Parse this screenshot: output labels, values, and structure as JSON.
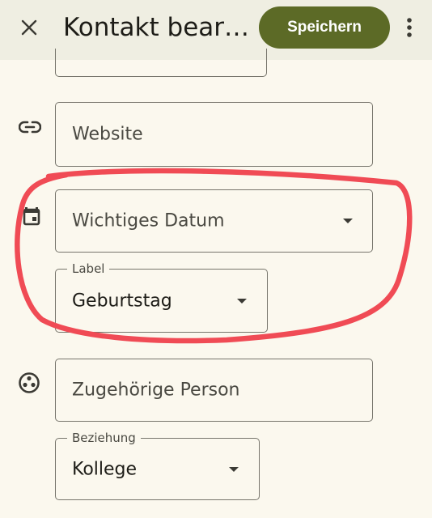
{
  "app_bar": {
    "title": "Kontakt bearb…",
    "save_label": "Speichern",
    "close_icon": "close-icon",
    "more_icon": "more-vert-icon"
  },
  "form": {
    "website": {
      "placeholder": "Website",
      "icon": "link-icon"
    },
    "important_date": {
      "placeholder": "Wichtiges Datum",
      "icon": "event-icon"
    },
    "date_label": {
      "label": "Label",
      "value": "Geburtstag"
    },
    "related_person": {
      "placeholder": "Zugehörige Person",
      "icon": "person-circle-icon"
    },
    "relationship": {
      "label": "Beziehung",
      "value": "Kollege"
    }
  },
  "colors": {
    "accent": "#5c6a26",
    "annotation": "#f04b55",
    "background": "#fbf8ee",
    "app_bar": "#efeee2"
  }
}
